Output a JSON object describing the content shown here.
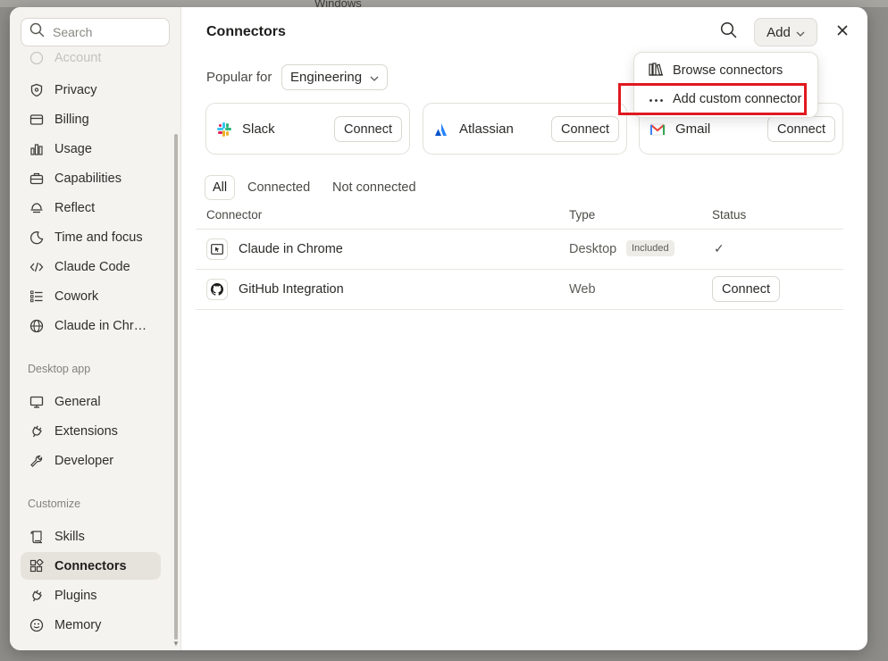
{
  "background": {
    "hint_text": "Windows"
  },
  "sidebar": {
    "search_placeholder": "Search",
    "top_items": [
      {
        "label": "Account",
        "icon": "account-icon"
      },
      {
        "label": "Privacy",
        "icon": "shield-icon"
      },
      {
        "label": "Billing",
        "icon": "card-icon"
      },
      {
        "label": "Usage",
        "icon": "bar-chart-icon"
      },
      {
        "label": "Capabilities",
        "icon": "briefcase-icon"
      },
      {
        "label": "Reflect",
        "icon": "reflect-icon"
      },
      {
        "label": "Time and focus",
        "icon": "moon-clock-icon"
      },
      {
        "label": "Claude Code",
        "icon": "code-icon"
      },
      {
        "label": "Cowork",
        "icon": "list-check-icon"
      },
      {
        "label": "Claude in Chr…",
        "icon": "globe-icon"
      }
    ],
    "desktop_section": "Desktop app",
    "desktop_items": [
      {
        "label": "General",
        "icon": "monitor-icon"
      },
      {
        "label": "Extensions",
        "icon": "plug-icon"
      },
      {
        "label": "Developer",
        "icon": "wrench-icon"
      }
    ],
    "customize_section": "Customize",
    "customize_items": [
      {
        "label": "Skills",
        "icon": "scroll-icon"
      },
      {
        "label": "Connectors",
        "icon": "connectors-icon",
        "active": true
      },
      {
        "label": "Plugins",
        "icon": "plug-icon"
      },
      {
        "label": "Memory",
        "icon": "memory-icon"
      }
    ]
  },
  "main": {
    "title": "Connectors",
    "add_label": "Add",
    "popular_label": "Popular for",
    "popular_value": "Engineering",
    "cards": [
      {
        "name": "Slack",
        "button": "Connect"
      },
      {
        "name": "Atlassian",
        "button": "Connect"
      },
      {
        "name": "Gmail",
        "button": "Connect"
      }
    ],
    "tabs": [
      "All",
      "Connected",
      "Not connected"
    ],
    "columns": [
      "Connector",
      "Type",
      "Status"
    ],
    "rows": [
      {
        "name": "Claude in Chrome",
        "type": "Desktop",
        "badge": "Included",
        "status": "✓"
      },
      {
        "name": "GitHub Integration",
        "type": "Web",
        "status_button": "Connect"
      }
    ],
    "dropdown": {
      "items": [
        {
          "label": "Browse connectors",
          "icon": "library-icon"
        },
        {
          "label": "Add custom connector",
          "icon": "more-dots-icon"
        }
      ]
    }
  },
  "colors": {
    "highlight": "#e0191f",
    "sidebar_bg": "#f4f3ef",
    "active_item_bg": "#e5e3dc"
  }
}
